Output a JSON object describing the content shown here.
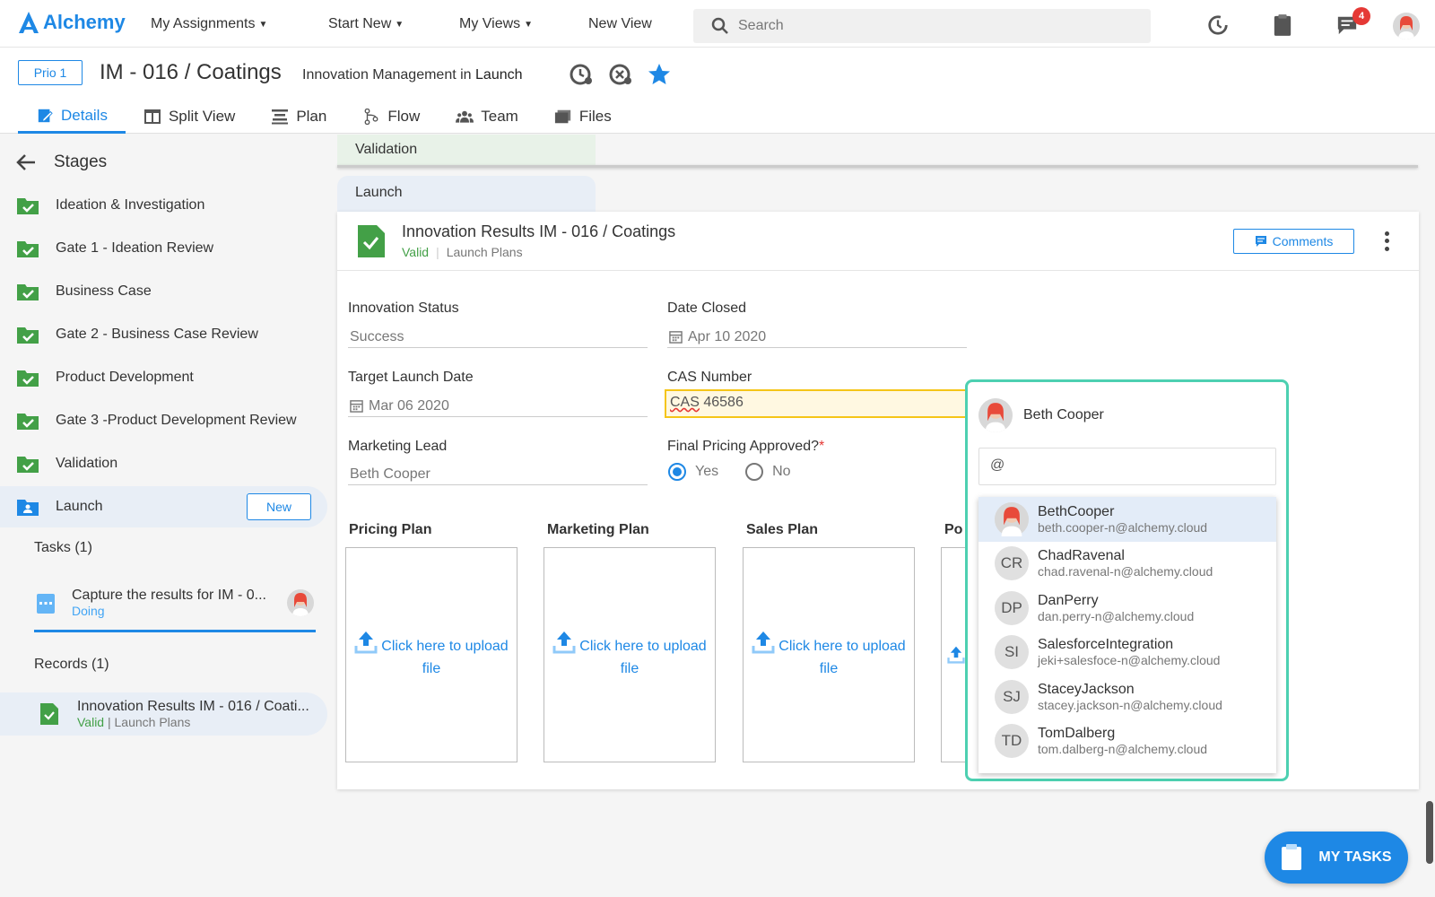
{
  "app": {
    "name": "Alchemy"
  },
  "nav": {
    "items": [
      {
        "label": "My Assignments",
        "dropdown": true
      },
      {
        "label": "Start New",
        "dropdown": true
      },
      {
        "label": "My Views",
        "dropdown": true
      },
      {
        "label": "New View",
        "dropdown": false
      }
    ],
    "search_placeholder": "Search",
    "notifications_count": "4"
  },
  "record": {
    "priority": "Prio 1",
    "title": "IM - 016 / Coatings",
    "subtitle_prefix": "Innovation Management in",
    "subtitle_stage": "Launch"
  },
  "tabs": [
    {
      "label": "Details",
      "active": true
    },
    {
      "label": "Split View"
    },
    {
      "label": "Plan"
    },
    {
      "label": "Flow"
    },
    {
      "label": "Team"
    },
    {
      "label": "Files"
    }
  ],
  "sidebar": {
    "title": "Stages",
    "stages": [
      {
        "label": "Ideation & Investigation"
      },
      {
        "label": "Gate 1 - Ideation Review"
      },
      {
        "label": "Business Case"
      },
      {
        "label": "Gate 2 - Business Case Review"
      },
      {
        "label": "Product Development"
      },
      {
        "label": "Gate 3 -Product Development Review"
      },
      {
        "label": "Validation"
      },
      {
        "label": "Launch",
        "active": true
      }
    ],
    "new_label": "New",
    "tasks_title": "Tasks (1)",
    "task": {
      "title": "Capture the results for IM - 0...",
      "status": "Doing"
    },
    "records_title": "Records (1)",
    "record": {
      "title": "Innovation Results IM - 016 / Coati...",
      "status": "Valid",
      "type": "Launch Plans"
    }
  },
  "main": {
    "validation_tab": "Validation",
    "launch_tab": "Launch",
    "card": {
      "title": "Innovation Results IM - 016 / Coatings",
      "status": "Valid",
      "type": "Launch Plans",
      "comments_label": "Comments"
    },
    "fields": {
      "innovation_status": {
        "label": "Innovation Status",
        "value": "Success"
      },
      "date_closed": {
        "label": "Date Closed",
        "value": "Apr 10 2020"
      },
      "target_launch": {
        "label": "Target Launch Date",
        "value": "Mar 06 2020"
      },
      "cas_number": {
        "label": "CAS Number",
        "prefix": "CAS",
        "value": " 46586"
      },
      "marketing_lead": {
        "label": "Marketing Lead",
        "value": "Beth Cooper"
      },
      "final_pricing": {
        "label": "Final Pricing Approved?",
        "required": "*",
        "yes": "Yes",
        "no": "No",
        "selected": "Yes"
      }
    },
    "plans": [
      {
        "title": "Pricing Plan",
        "upload": "Click here to upload file"
      },
      {
        "title": "Marketing Plan",
        "upload": "Click here to upload file"
      },
      {
        "title": "Sales Plan",
        "upload": "Click here to upload file"
      },
      {
        "title": "Po",
        "upload": ""
      }
    ]
  },
  "mention": {
    "current_user": "Beth Cooper",
    "input_value": "@",
    "users": [
      {
        "initials": "",
        "name": "BethCooper",
        "email": "beth.cooper-n@alchemy.cloud",
        "active": true
      },
      {
        "initials": "CR",
        "name": "ChadRavenal",
        "email": "chad.ravenal-n@alchemy.cloud"
      },
      {
        "initials": "DP",
        "name": "DanPerry",
        "email": "dan.perry-n@alchemy.cloud"
      },
      {
        "initials": "SI",
        "name": "SalesforceIntegration",
        "email": "jeki+salesfoce-n@alchemy.cloud"
      },
      {
        "initials": "SJ",
        "name": "StaceyJackson",
        "email": "stacey.jackson-n@alchemy.cloud"
      },
      {
        "initials": "TD",
        "name": "TomDalberg",
        "email": "tom.dalberg-n@alchemy.cloud"
      }
    ]
  },
  "my_tasks_label": "MY TASKS",
  "colors": {
    "accent": "#1e88e5",
    "success": "#43a047",
    "mention_border": "#4dd0b1",
    "highlight": "#f5c518"
  }
}
